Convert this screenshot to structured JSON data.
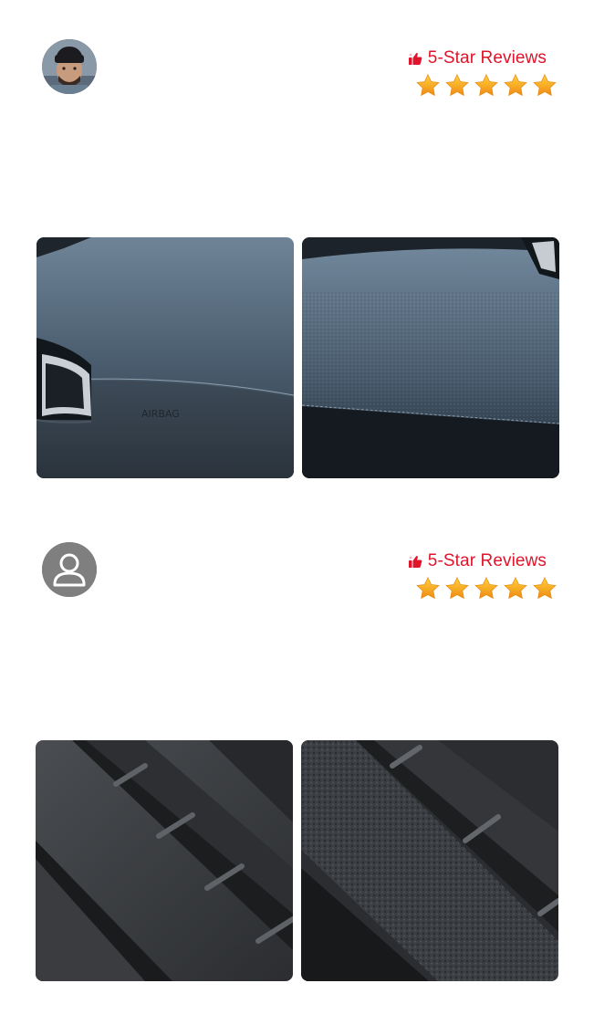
{
  "reviews": [
    {
      "avatar": "user-photo",
      "badge_label": "5-Star Reviews",
      "badge_icon": "thumbs-up-icon",
      "rating": 5,
      "rating_max": 5,
      "photos": [
        "dashboard-airbag-panel-before",
        "dashboard-airbag-panel-after"
      ],
      "photo_text": "AIRBAG"
    },
    {
      "avatar": "default-user-icon",
      "badge_label": "5-Star Reviews",
      "badge_icon": "thumbs-up-icon",
      "rating": 5,
      "rating_max": 5,
      "photos": [
        "door-sill-trim-before",
        "door-sill-trim-after"
      ]
    }
  ],
  "colors": {
    "badge_text": "#e0142a",
    "star": "#f6a51b",
    "default_avatar_bg": "#7f7f7f"
  }
}
